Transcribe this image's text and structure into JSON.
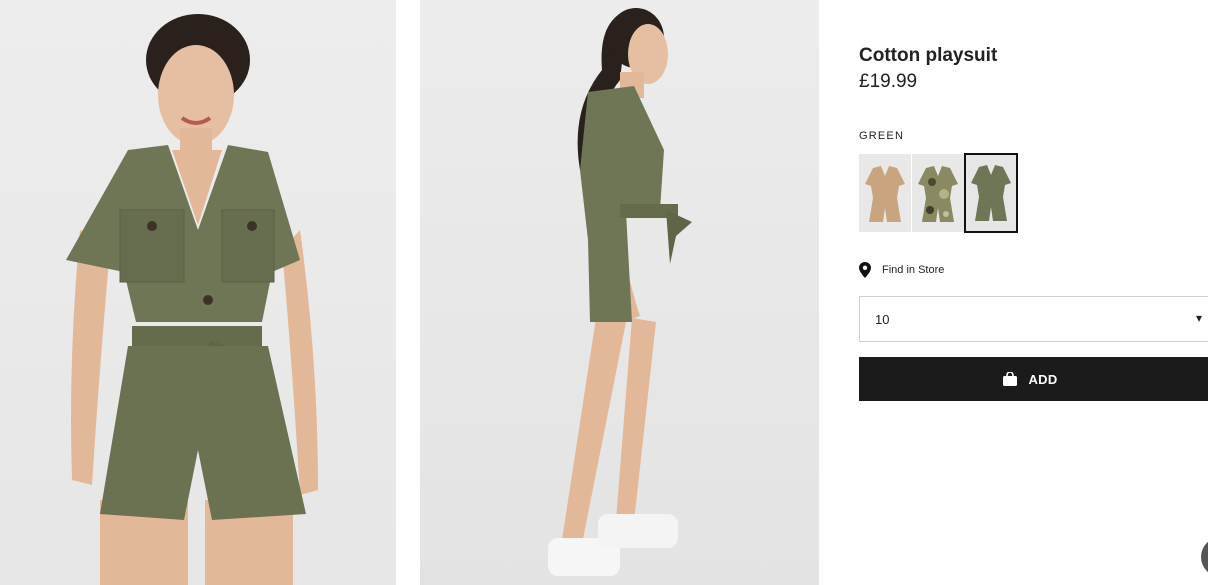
{
  "product": {
    "title": "Cotton playsuit",
    "price": "£19.99",
    "color_label": "GREEN",
    "colors": [
      {
        "name": "beige",
        "hex": "#c9a47f",
        "selected": false
      },
      {
        "name": "camouflage",
        "hex": "#8a8a62",
        "selected": false
      },
      {
        "name": "khaki green",
        "hex": "#6f7656",
        "selected": true
      }
    ]
  },
  "store": {
    "label": "Find in Store",
    "icon": "location-pin-icon"
  },
  "size": {
    "selected": "10",
    "icon": "chevron-down-icon"
  },
  "add": {
    "label": "ADD",
    "icon": "shopping-bag-icon"
  },
  "theme": {
    "button_bg": "#1b1b1b",
    "garment": "#6f7656",
    "skin": "#e2b898",
    "background": "#ebebeb"
  }
}
